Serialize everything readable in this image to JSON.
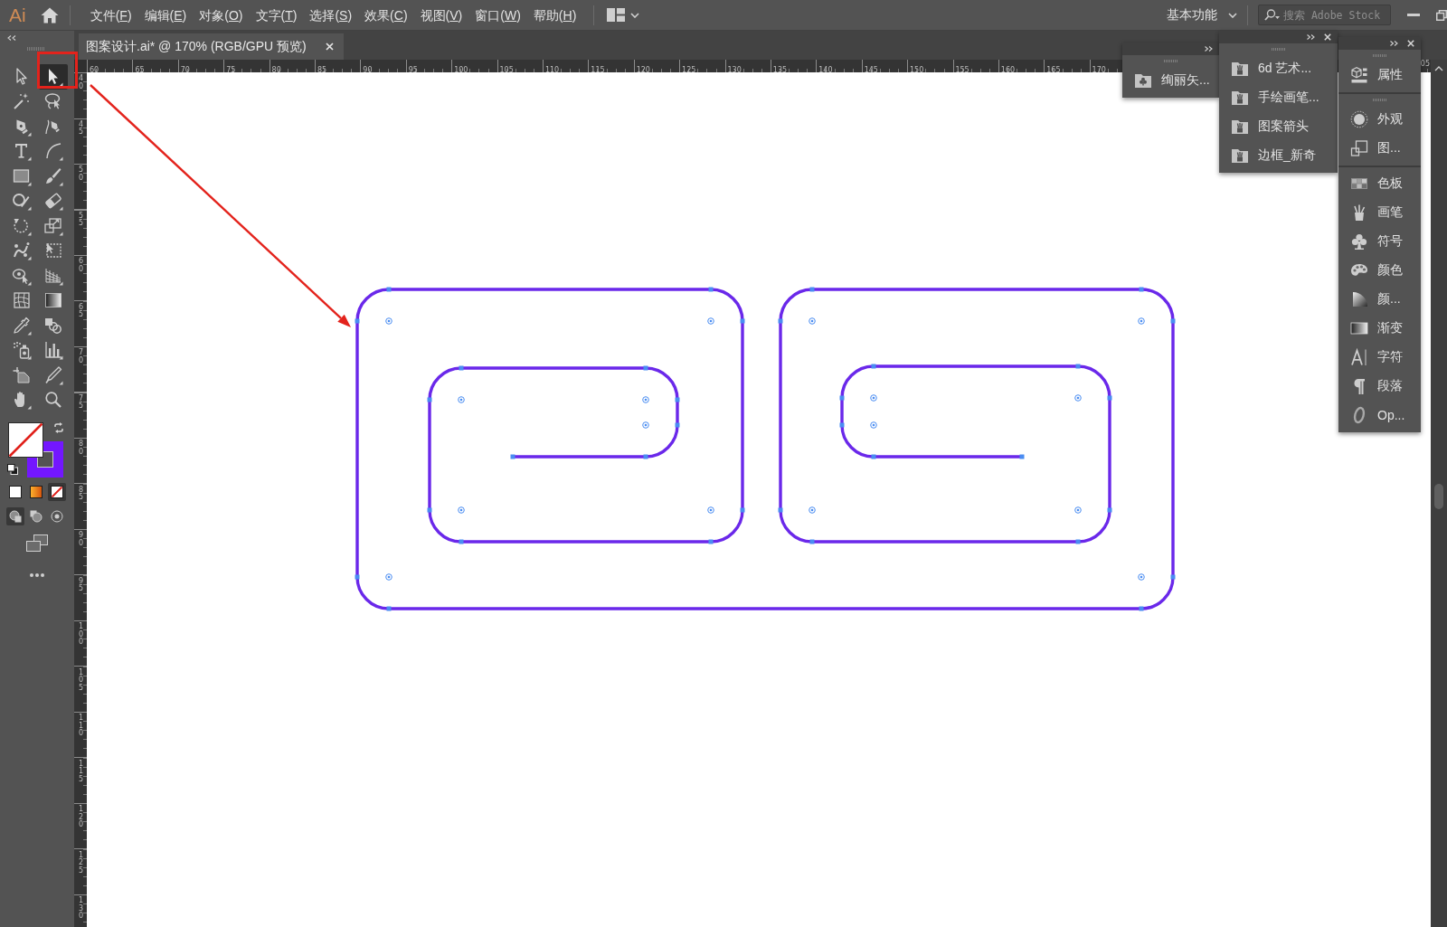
{
  "menu_bar": {
    "logo": "Ai",
    "menus": [
      {
        "prefix": "文件(",
        "mnemonic": "F",
        "suffix": ")"
      },
      {
        "prefix": "编辑(",
        "mnemonic": "E",
        "suffix": ")"
      },
      {
        "prefix": "对象(",
        "mnemonic": "O",
        "suffix": ")"
      },
      {
        "prefix": "文字(",
        "mnemonic": "T",
        "suffix": ")"
      },
      {
        "prefix": "选择(",
        "mnemonic": "S",
        "suffix": ")"
      },
      {
        "prefix": "效果(",
        "mnemonic": "C",
        "suffix": ")"
      },
      {
        "prefix": "视图(",
        "mnemonic": "V",
        "suffix": ")"
      },
      {
        "prefix": "窗口(",
        "mnemonic": "W",
        "suffix": ")"
      },
      {
        "prefix": "帮助(",
        "mnemonic": "H",
        "suffix": ")"
      }
    ],
    "workspace": "基本功能",
    "search": {
      "placeholder": "搜索 Adobe Stock"
    }
  },
  "tools_panel": {
    "tools": [
      {
        "kind": "pointer-outline",
        "selected": false,
        "flyout": false
      },
      {
        "kind": "pointer-solid",
        "selected": true,
        "flyout": true
      },
      {
        "kind": "magic-wand",
        "selected": false,
        "flyout": false
      },
      {
        "kind": "lasso",
        "selected": false,
        "flyout": false
      },
      {
        "kind": "pen",
        "selected": false,
        "flyout": true
      },
      {
        "kind": "curve-pen",
        "selected": false,
        "flyout": false
      },
      {
        "kind": "text-t",
        "selected": false,
        "flyout": true
      },
      {
        "kind": "arc",
        "selected": false,
        "flyout": true
      },
      {
        "kind": "rectangle",
        "selected": false,
        "flyout": true
      },
      {
        "kind": "paintbrush",
        "selected": false,
        "flyout": true
      },
      {
        "kind": "shaper",
        "selected": false,
        "flyout": true
      },
      {
        "kind": "eraser",
        "selected": false,
        "flyout": true
      },
      {
        "kind": "rotate",
        "selected": false,
        "flyout": true
      },
      {
        "kind": "scale",
        "selected": false,
        "flyout": true
      },
      {
        "kind": "warp",
        "selected": false,
        "flyout": true
      },
      {
        "kind": "free-transform",
        "selected": false,
        "flyout": false
      },
      {
        "kind": "shape-builder",
        "selected": false,
        "flyout": true
      },
      {
        "kind": "perspective-grid",
        "selected": false,
        "flyout": true
      },
      {
        "kind": "mesh",
        "selected": false,
        "flyout": false
      },
      {
        "kind": "gradient",
        "selected": false,
        "flyout": false
      },
      {
        "kind": "eyedropper",
        "selected": false,
        "flyout": true
      },
      {
        "kind": "blend",
        "selected": false,
        "flyout": false
      },
      {
        "kind": "sprayer",
        "selected": false,
        "flyout": true
      },
      {
        "kind": "bar-chart",
        "selected": false,
        "flyout": true
      },
      {
        "kind": "artboard",
        "selected": false,
        "flyout": false
      },
      {
        "kind": "knife",
        "selected": false,
        "flyout": true
      },
      {
        "kind": "hand",
        "selected": false,
        "flyout": true
      },
      {
        "kind": "magnifier",
        "selected": false,
        "flyout": false
      }
    ],
    "color_modes": [
      {
        "kind": "solid",
        "selected": false
      },
      {
        "kind": "gradient",
        "selected": false
      },
      {
        "kind": "none",
        "selected": true
      }
    ],
    "draw_modes": [
      {
        "kind": "normal",
        "selected": true
      },
      {
        "kind": "behind",
        "selected": false
      },
      {
        "kind": "inside",
        "selected": false
      }
    ]
  },
  "document_tab": {
    "title": "图案设计.ai* @ 170% (RGB/GPU 预览)"
  },
  "rulers": {
    "horizontal": [
      "60",
      "65",
      "70",
      "75",
      "80",
      "85",
      "90",
      "95",
      "100",
      "105",
      "110",
      "115",
      "120",
      "125",
      "130",
      "135",
      "140",
      "145",
      "150",
      "155",
      "160",
      "165",
      "170"
    ],
    "horizontal_cut": "05",
    "vertical": [
      "40",
      "45",
      "50",
      "55",
      "60",
      "65",
      "70",
      "75",
      "80",
      "85",
      "90",
      "95",
      "100",
      "105",
      "110",
      "115",
      "120",
      "125",
      "130"
    ]
  },
  "panels": [
    {
      "groups": [
        [
          {
            "kind": "symbol-library",
            "label": "绚丽矢..."
          }
        ]
      ]
    },
    {
      "groups": [
        [
          {
            "kind": "brush-library",
            "label": "6d 艺术..."
          },
          {
            "kind": "brush-library",
            "label": "手绘画笔..."
          },
          {
            "kind": "brush-library",
            "label": "图案箭头"
          },
          {
            "kind": "brush-library",
            "label": "边框_新奇"
          }
        ]
      ]
    },
    {
      "groups": [
        [
          {
            "kind": "properties",
            "label": "属性"
          }
        ],
        [
          {
            "kind": "appearance",
            "label": "外观"
          },
          {
            "kind": "graphic-styles",
            "label": "图..."
          }
        ],
        [
          {
            "kind": "swatches",
            "label": "色板"
          },
          {
            "kind": "brushes",
            "label": "画笔"
          },
          {
            "kind": "symbols",
            "label": "符号"
          },
          {
            "kind": "color",
            "label": "颜色"
          },
          {
            "kind": "color-guide",
            "label": "颜..."
          },
          {
            "kind": "gradient",
            "label": "渐变"
          },
          {
            "kind": "character",
            "label": "字符"
          },
          {
            "kind": "paragraph",
            "label": "段落"
          },
          {
            "kind": "opentype",
            "label": "Op..."
          }
        ]
      ]
    }
  ]
}
